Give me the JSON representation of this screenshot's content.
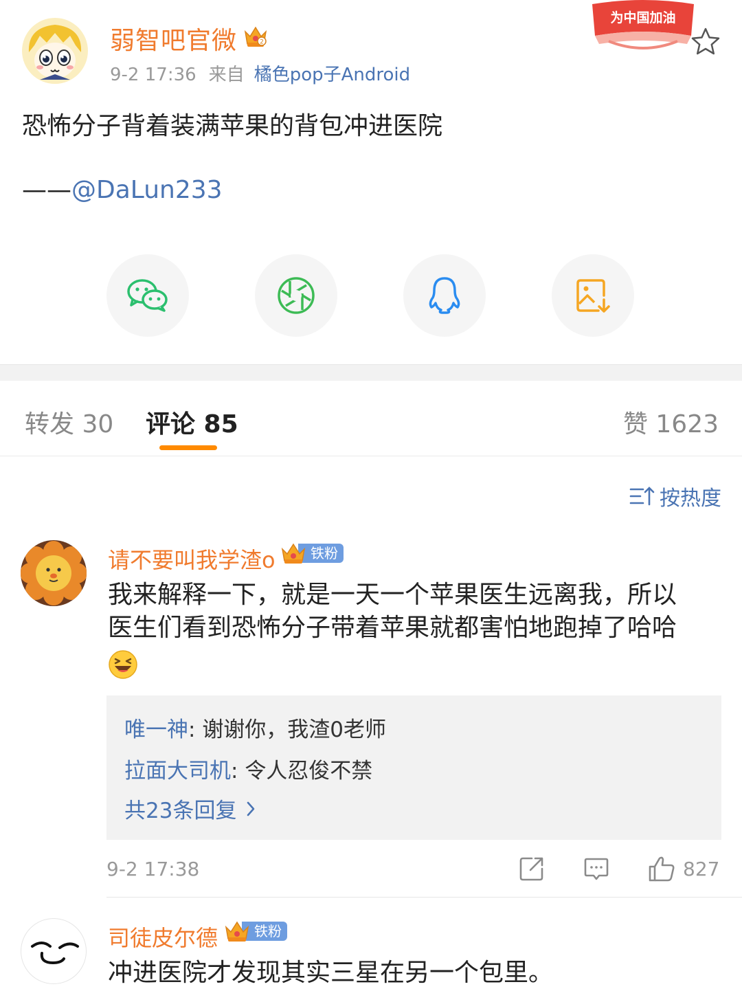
{
  "post": {
    "author": "弱智吧官微",
    "time": "9-2 17:36",
    "from_label": "来自",
    "source": "橘色pop子Android",
    "promo": "为中国加油",
    "text": "恐怖分子背着装满苹果的背包冲进医院",
    "credit_dash": "——",
    "credit_mention": "@DaLun233",
    "share_icons": [
      "wechat-icon",
      "moments-icon",
      "qq-icon",
      "save-image-icon"
    ]
  },
  "tabs": {
    "repost": "转发 30",
    "comments": "评论 85",
    "likes": "赞 1623"
  },
  "sort_label": "按热度",
  "comments": [
    {
      "user": "请不要叫我学渣o",
      "badge": "铁粉",
      "text_line1": "我来解释一下，就是一天一个苹果医生远离我，所以",
      "text_line2": "医生们看到恐怖分子带着苹果就都害怕地跑掉了哈哈",
      "emoji": "laughing-emoji",
      "replies": [
        {
          "user": "唯一神",
          "sep": ": ",
          "text": "谢谢你，我渣0老师"
        },
        {
          "user": "拉面大司机",
          "sep": ": ",
          "text": "令人忍俊不禁"
        }
      ],
      "more_replies": "共23条回复",
      "time": "9-2 17:38",
      "like_count": "827"
    },
    {
      "user": "司徒皮尔德",
      "badge": "铁粉",
      "text": "冲进医院才发现其实三星在另一个包里。"
    }
  ],
  "colors": {
    "accent_orange": "#ff8a00",
    "username_orange": "#f07b2e",
    "link_blue": "#4a74b3"
  }
}
